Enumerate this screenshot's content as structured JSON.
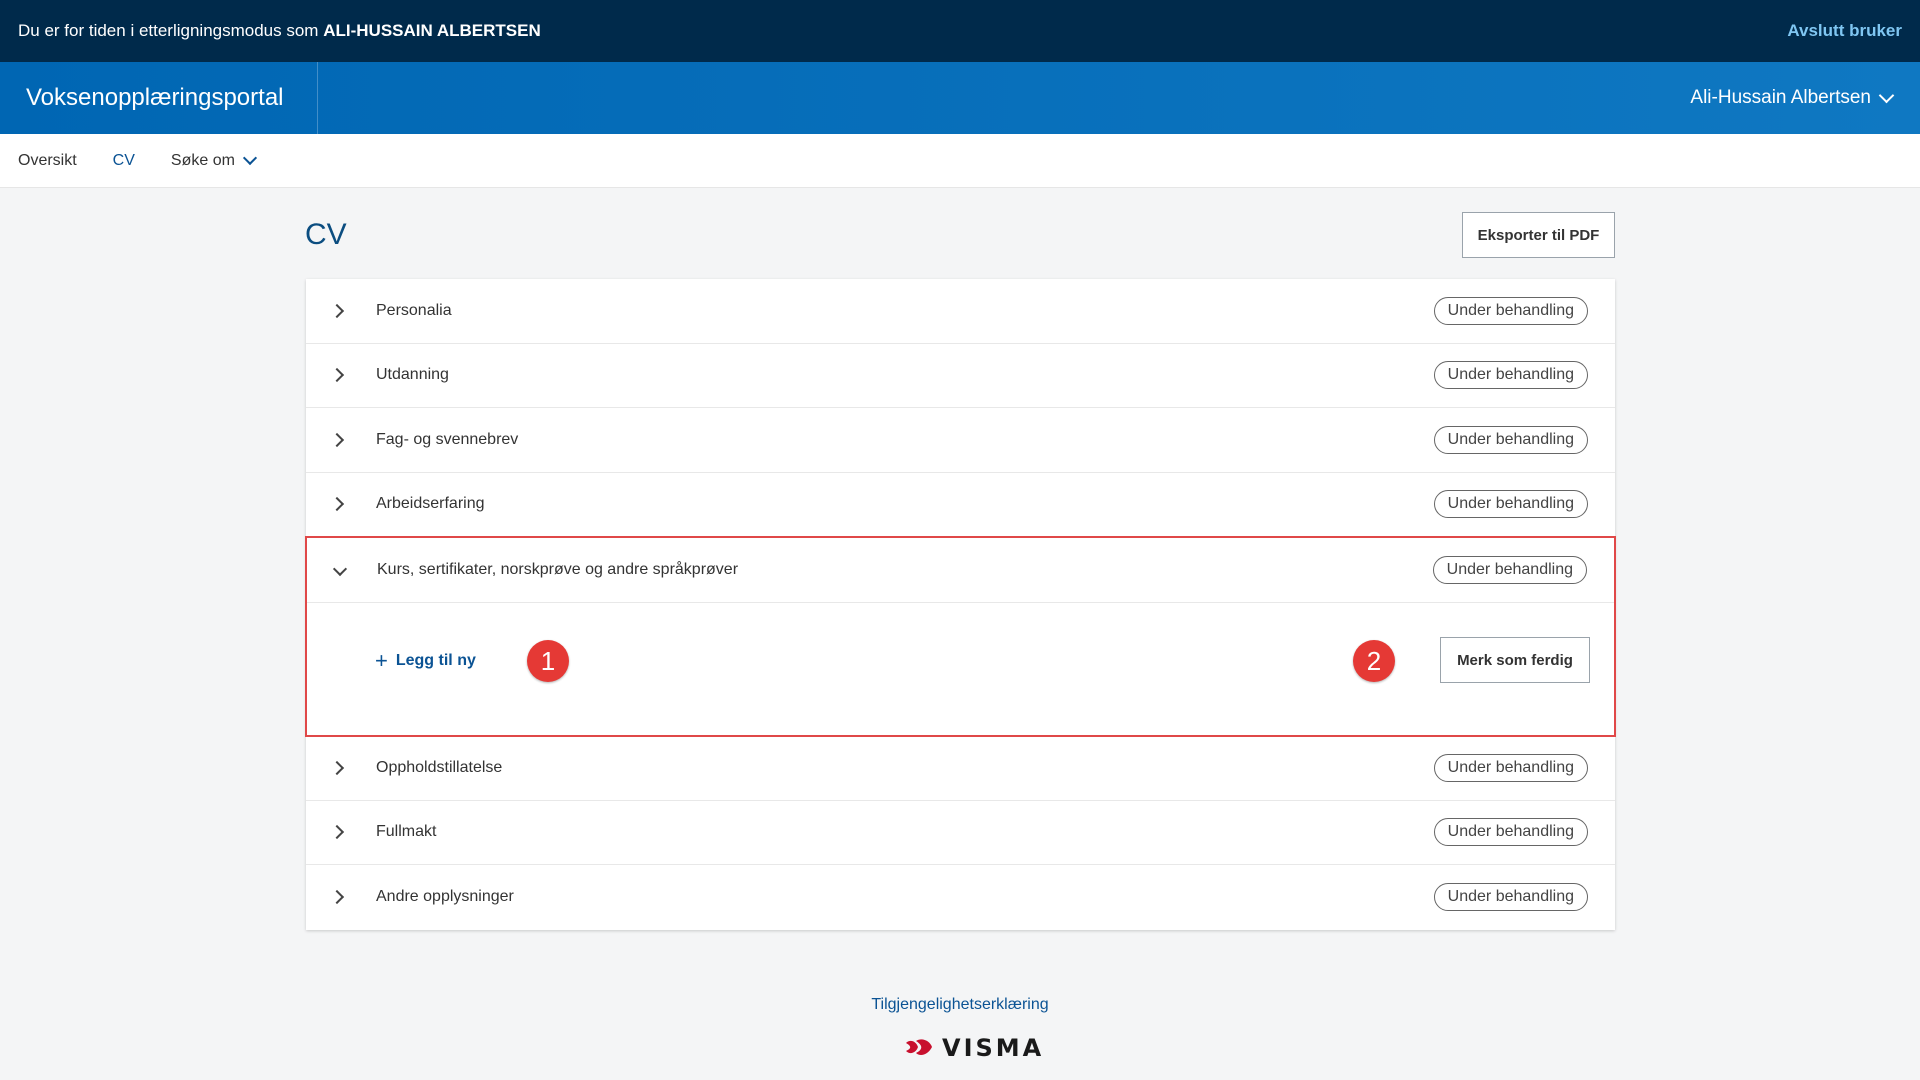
{
  "impersonation": {
    "prefix": "Du er for tiden i etterligningsmodus som",
    "user": "ALI-HUSSAIN ALBERTSEN",
    "end_label": "Avslutt bruker"
  },
  "header": {
    "brand": "Voksenopplæringsportal",
    "user_name": "Ali-Hussain Albertsen"
  },
  "nav": {
    "items": [
      {
        "label": "Oversikt"
      },
      {
        "label": "CV"
      },
      {
        "label": "Søke om"
      }
    ]
  },
  "page": {
    "title": "CV",
    "export_label": "Eksporter til PDF"
  },
  "sections": [
    {
      "label": "Personalia",
      "status": "Under behandling"
    },
    {
      "label": "Utdanning",
      "status": "Under behandling"
    },
    {
      "label": "Fag- og svennebrev",
      "status": "Under behandling"
    },
    {
      "label": "Arbeidserfaring",
      "status": "Under behandling"
    },
    {
      "label": "Kurs, sertifikater, norskprøve og andre språkprøver",
      "status": "Under behandling"
    },
    {
      "label": "Oppholdstillatelse",
      "status": "Under behandling"
    },
    {
      "label": "Fullmakt",
      "status": "Under behandling"
    },
    {
      "label": "Andre opplysninger",
      "status": "Under behandling"
    }
  ],
  "expanded": {
    "add_label": "Legg til ny",
    "finish_label": "Merk som ferdig",
    "marker_1": "1",
    "marker_2": "2"
  },
  "footer": {
    "accessibility_label": "Tilgjengelighetserklæring",
    "logo_text": "VISMA"
  },
  "colors": {
    "top_bar": "#002a4b",
    "header_blue": "#0066b3",
    "link_blue": "#0b5394",
    "highlight_red": "#e04848"
  }
}
